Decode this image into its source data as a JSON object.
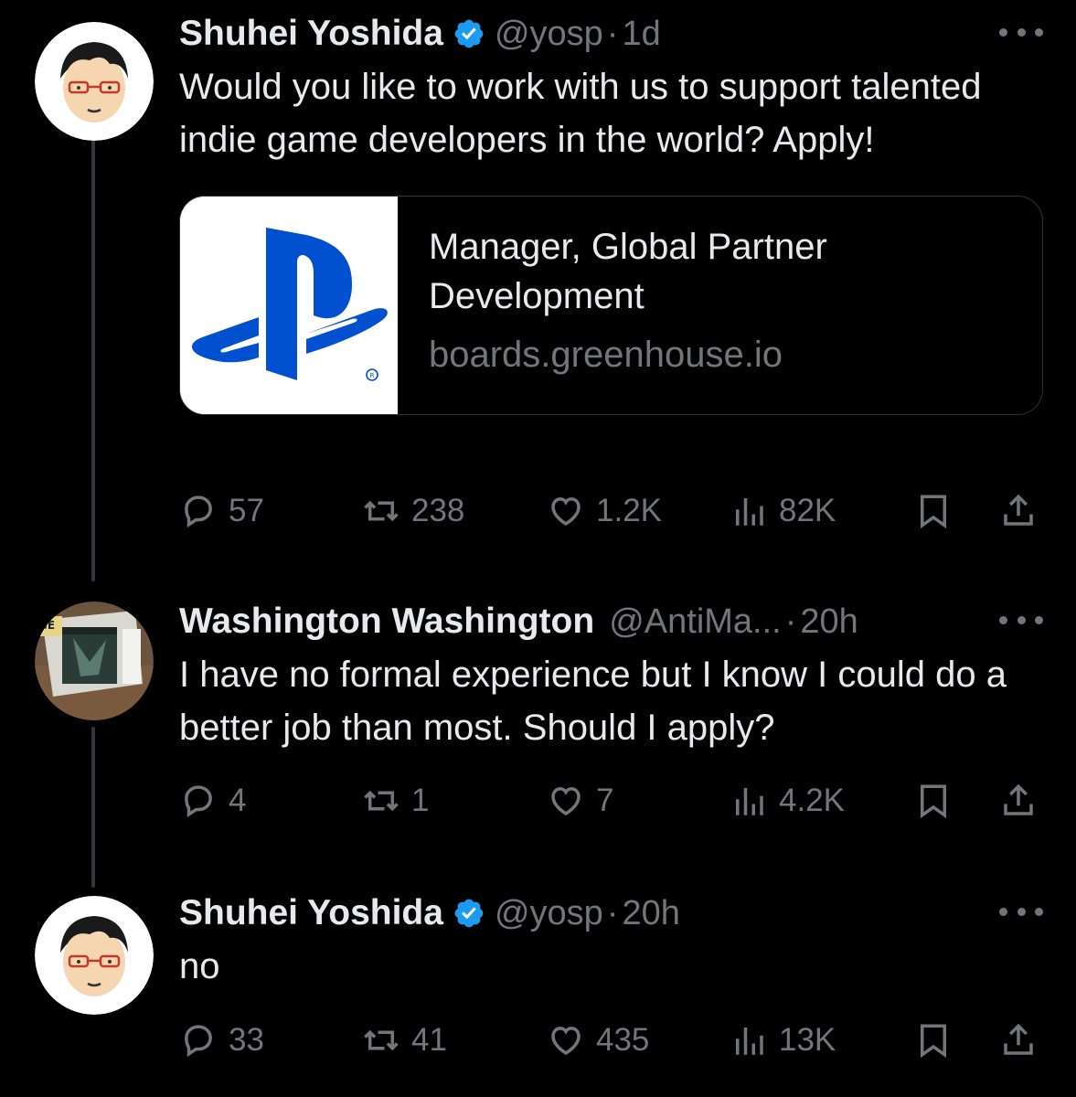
{
  "thread": [
    {
      "author": "Shuhei Yoshida",
      "verified": true,
      "handle": "@yosp",
      "time": "1d",
      "text": "Would you like to work with us to support talented indie game developers in the world? Apply!",
      "card": {
        "title": "Manager, Global Partner Development",
        "domain": "boards.greenhouse.io",
        "thumbnail_icon": "playstation-logo"
      },
      "metrics": {
        "replies": "57",
        "reposts": "238",
        "likes": "1.2K",
        "views": "82K"
      }
    },
    {
      "author": "Washington Washington",
      "verified": false,
      "handle": "@AntiMa...",
      "time": "20h",
      "text": "I have no formal experience but I know I could do a better job than most. Should I apply?",
      "metrics": {
        "replies": "4",
        "reposts": "1",
        "likes": "7",
        "views": "4.2K"
      }
    },
    {
      "author": "Shuhei Yoshida",
      "verified": true,
      "handle": "@yosp",
      "time": "20h",
      "text": "no",
      "metrics": {
        "replies": "33",
        "reposts": "41",
        "likes": "435",
        "views": "13K"
      }
    }
  ],
  "separator": "·",
  "colors": {
    "background": "#000000",
    "text": "#e7e9ea",
    "muted": "#71767b",
    "verified": "#1d9bf0",
    "playstation": "#0050d0"
  }
}
